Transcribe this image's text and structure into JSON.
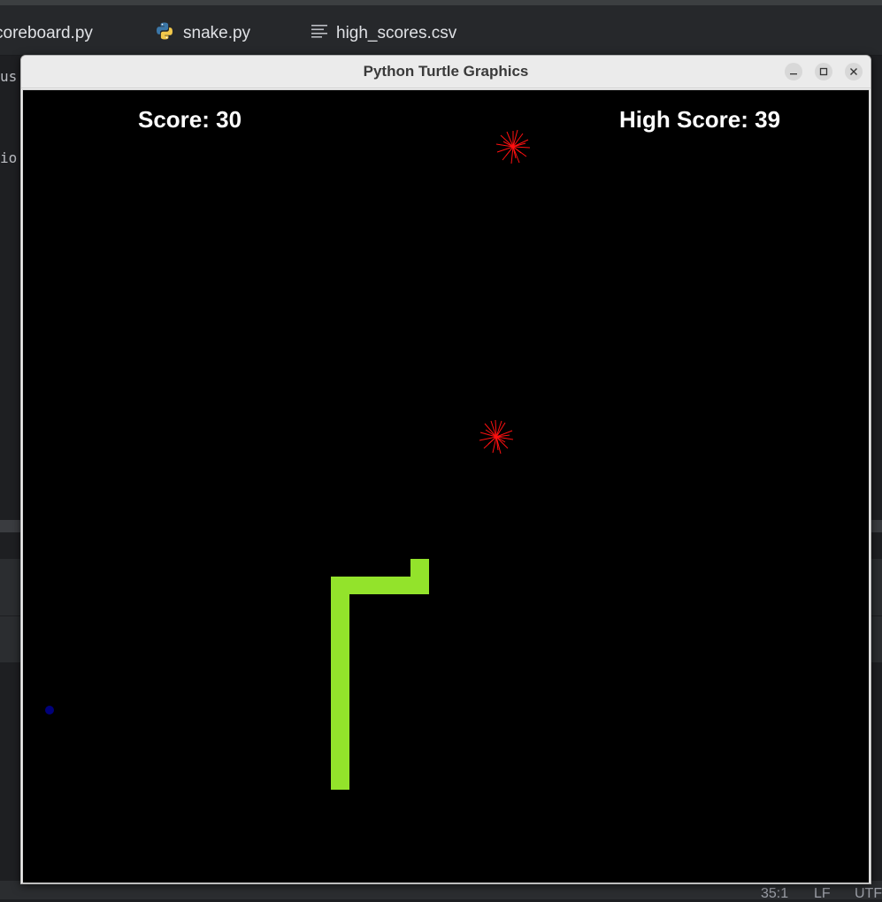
{
  "ide": {
    "tabs": [
      {
        "label": "coreboard.py",
        "icon": "python-file-icon"
      },
      {
        "label": "snake.py",
        "icon": "python-file-icon"
      },
      {
        "label": "high_scores.csv",
        "icon": "text-file-icon"
      }
    ],
    "code_fragments": [
      "us",
      "io"
    ],
    "status": {
      "position": "35:1",
      "line_ending": "LF",
      "encoding": "UTF"
    }
  },
  "window": {
    "title": "Python Turtle Graphics",
    "buttons": [
      "minimize",
      "maximize",
      "close"
    ]
  },
  "game": {
    "score_text": "Score: 30",
    "high_score_text": "High Score: 39",
    "score": 30,
    "high_score": 39,
    "colors": {
      "snake": "#93e32b",
      "background": "#000000",
      "text": "#ffffff",
      "food": "#00007a",
      "burst": "#ff0000"
    }
  }
}
